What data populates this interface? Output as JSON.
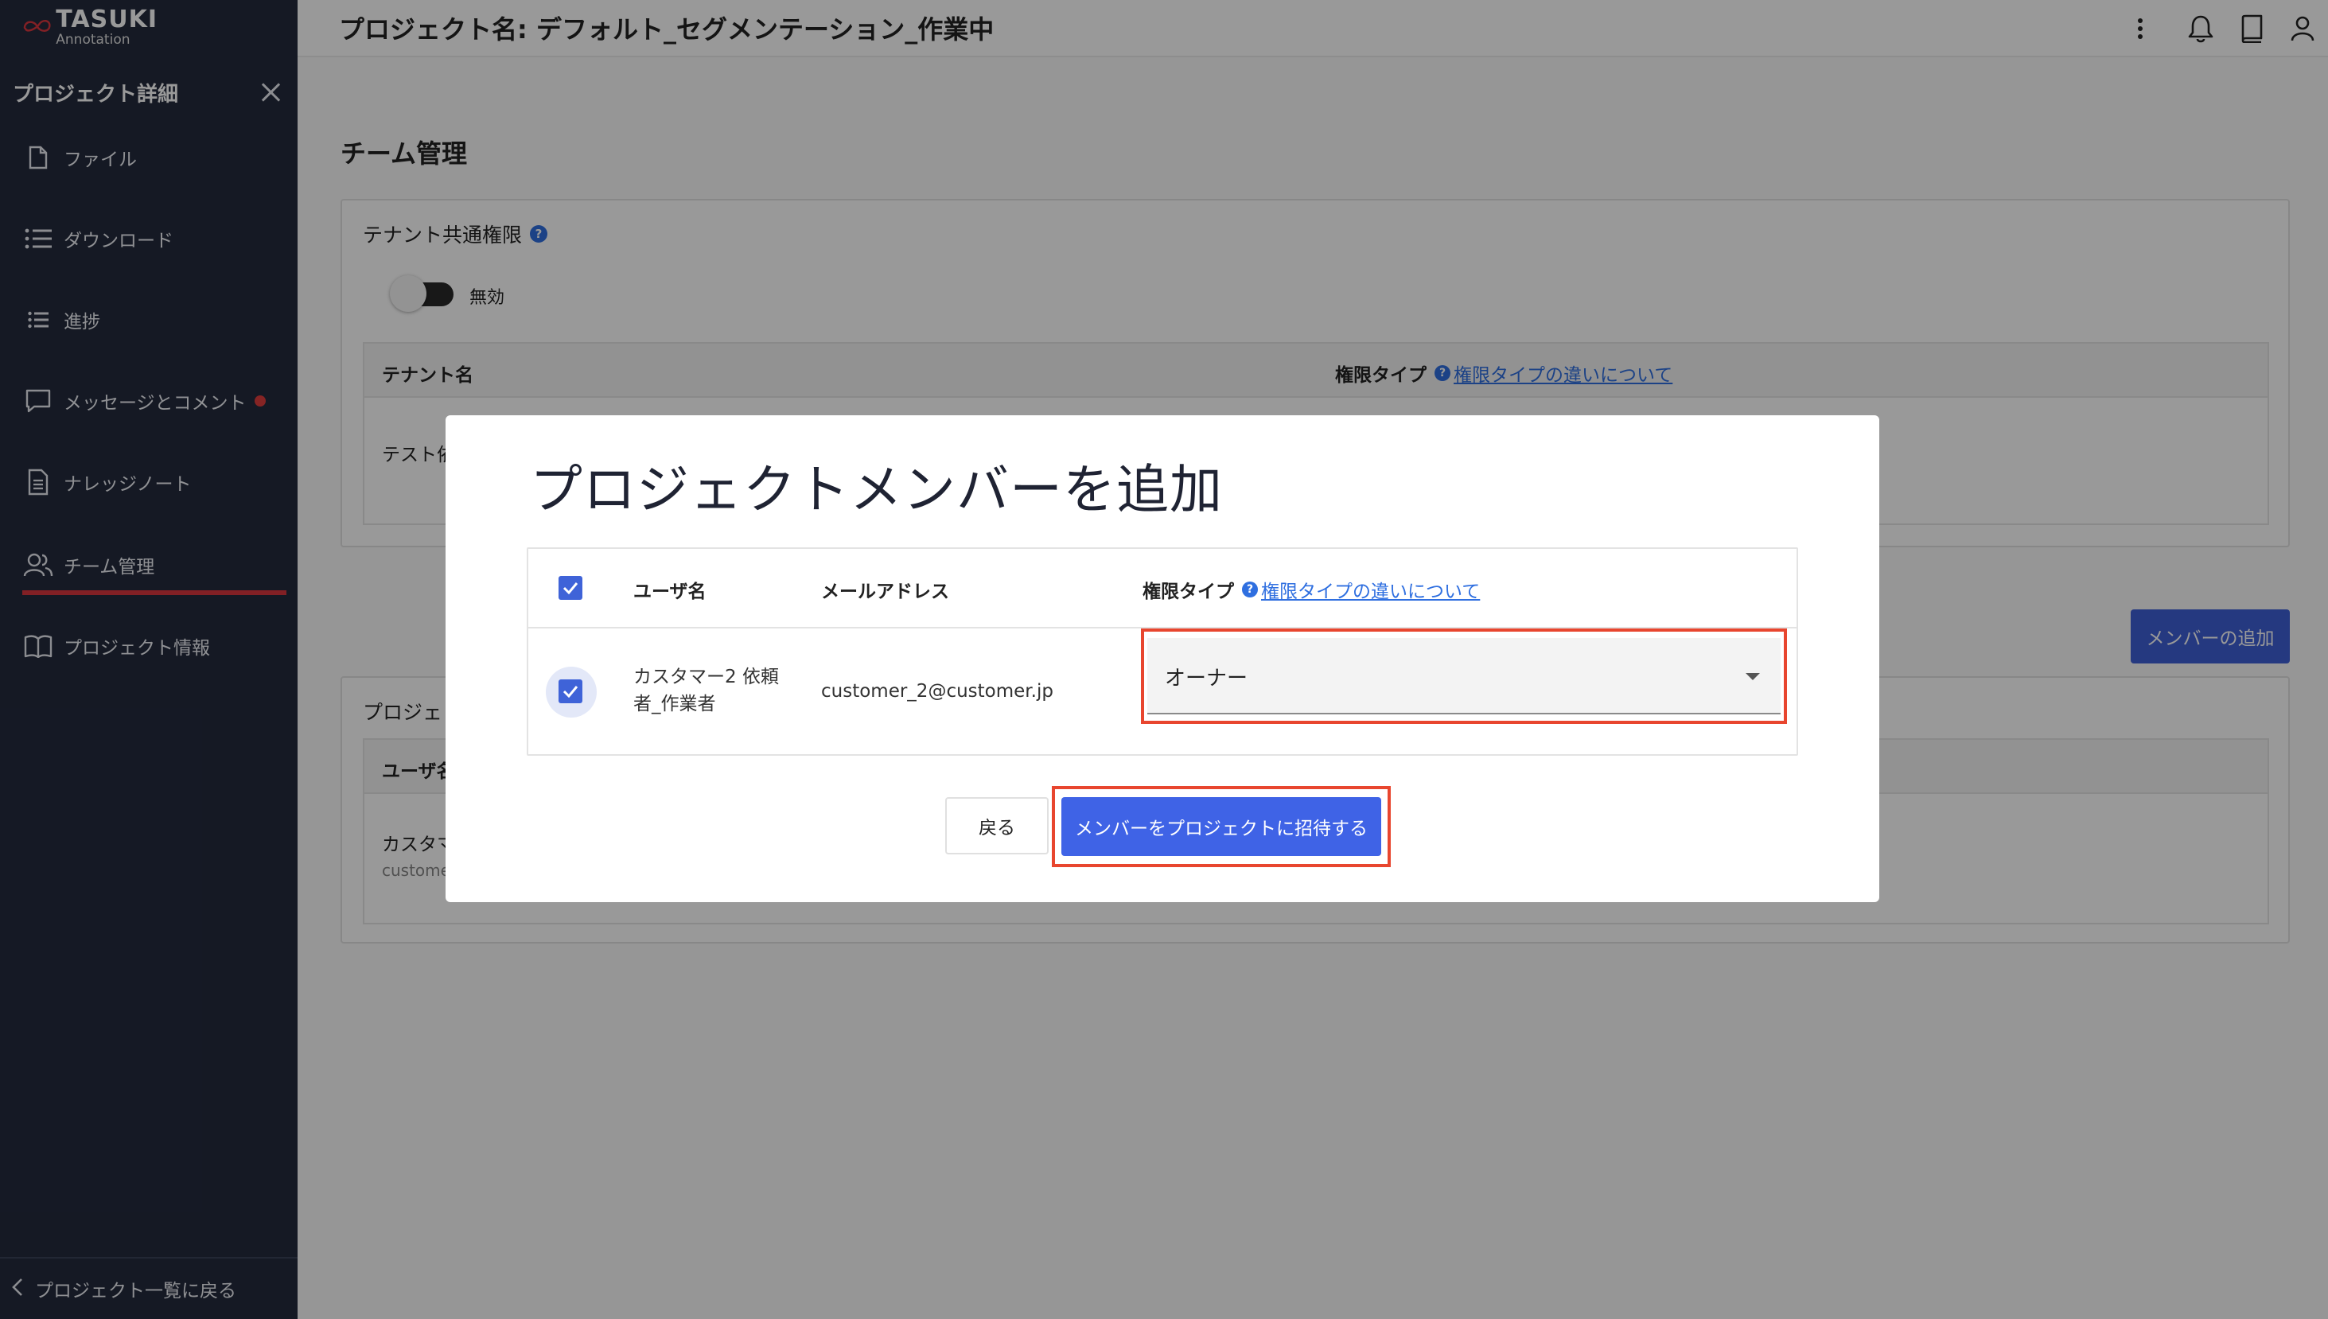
{
  "brand": {
    "name": "TASUKI",
    "sub": "Annotation",
    "accent": "#d9363e"
  },
  "sidebar": {
    "title": "プロジェクト詳細",
    "items": [
      {
        "label": "ファイル",
        "icon": "file-icon"
      },
      {
        "label": "ダウンロード",
        "icon": "list-icon"
      },
      {
        "label": "進捗",
        "icon": "list-icon"
      },
      {
        "label": "メッセージとコメント",
        "icon": "chat-icon",
        "badge": true
      },
      {
        "label": "ナレッジノート",
        "icon": "document-icon"
      },
      {
        "label": "チーム管理",
        "icon": "users-icon",
        "active": true
      },
      {
        "label": "プロジェクト情報",
        "icon": "book-icon"
      }
    ],
    "footer": "プロジェクト一覧に戻る"
  },
  "header": {
    "title": "プロジェクト名: デフォルト_セグメンテーション_作業中"
  },
  "main": {
    "section_title": "チーム管理",
    "tenant": {
      "label": "テナント共通権限",
      "toggle_label": "無効",
      "col_tenant": "テナント名",
      "col_permission": "権限タイプ",
      "permission_link": "権限タイプの違いについて",
      "row_tenant": "テスト依"
    },
    "add_member_button": "メンバーの追加",
    "members": {
      "title": "プロジェ",
      "col_user": "ユーザ名",
      "row_name": "カスタマ",
      "row_email": "custome"
    }
  },
  "modal": {
    "title": "プロジェクトメンバーを追加",
    "col_user": "ユーザ名",
    "col_email": "メールアドレス",
    "col_permission": "権限タイプ",
    "permission_link": "権限タイプの違いについて",
    "row": {
      "name_line1": "カスタマー2 依頼",
      "name_line2": "者_作業者",
      "email": "customer_2@customer.jp",
      "permission": "オーナー"
    },
    "back_button": "戻る",
    "invite_button": "メンバーをプロジェクトに招待する"
  }
}
